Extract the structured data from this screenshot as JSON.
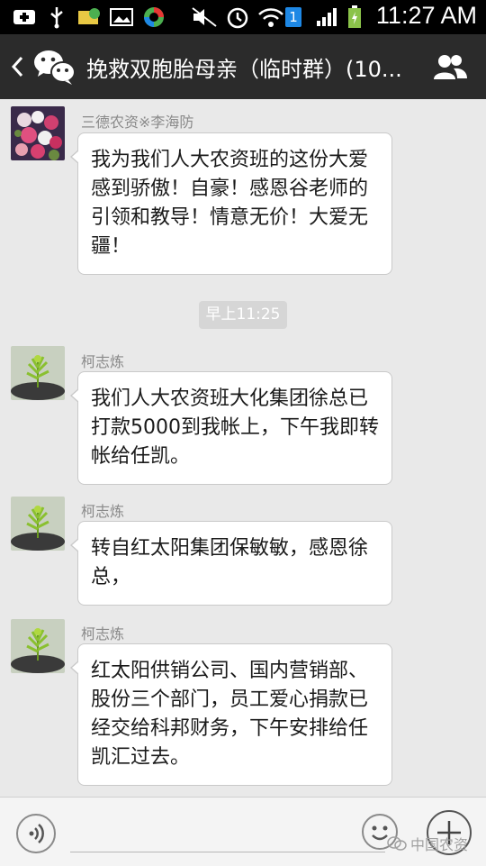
{
  "status_bar": {
    "time": "11:27 AM",
    "notification_badge": "1",
    "icons": [
      "add-icon",
      "usb-icon",
      "mail-icon",
      "image-icon",
      "app-icon",
      "mute-icon",
      "alarm-icon",
      "wifi-icon",
      "signal-icon",
      "battery-icon"
    ]
  },
  "header": {
    "title": "挽救双胞胎母亲（临时群）(10..."
  },
  "timestamp": "早上11:25",
  "messages": [
    {
      "sender": "三德农资※李海防",
      "text": "我为我们人大农资班的这份大爱感到骄傲！自豪！感恩谷老师的引领和教导！情意无价！大爱无疆！",
      "avatar": "flower-bouquet-avatar"
    },
    {
      "sender": "柯志炼",
      "text": "我们人大农资班大化集团徐总已打款5000到我帐上，下午我即转帐给任凯。",
      "avatar": "plant-avatar"
    },
    {
      "sender": "柯志炼",
      "text": "转自红太阳集团保敏敏，感恩徐总，",
      "avatar": "plant-avatar"
    },
    {
      "sender": "柯志炼",
      "text": "红太阳供销公司、国内营销部、股份三个部门，员工爱心捐款已经交给科邦财务，下午安排给任凯汇过去。",
      "avatar": "plant-avatar"
    }
  ],
  "watermark": "中国农资",
  "colors": {
    "title_bar": "#2b2b2b",
    "chat_bg": "#e9e9e9",
    "bubble": "#ffffff"
  }
}
